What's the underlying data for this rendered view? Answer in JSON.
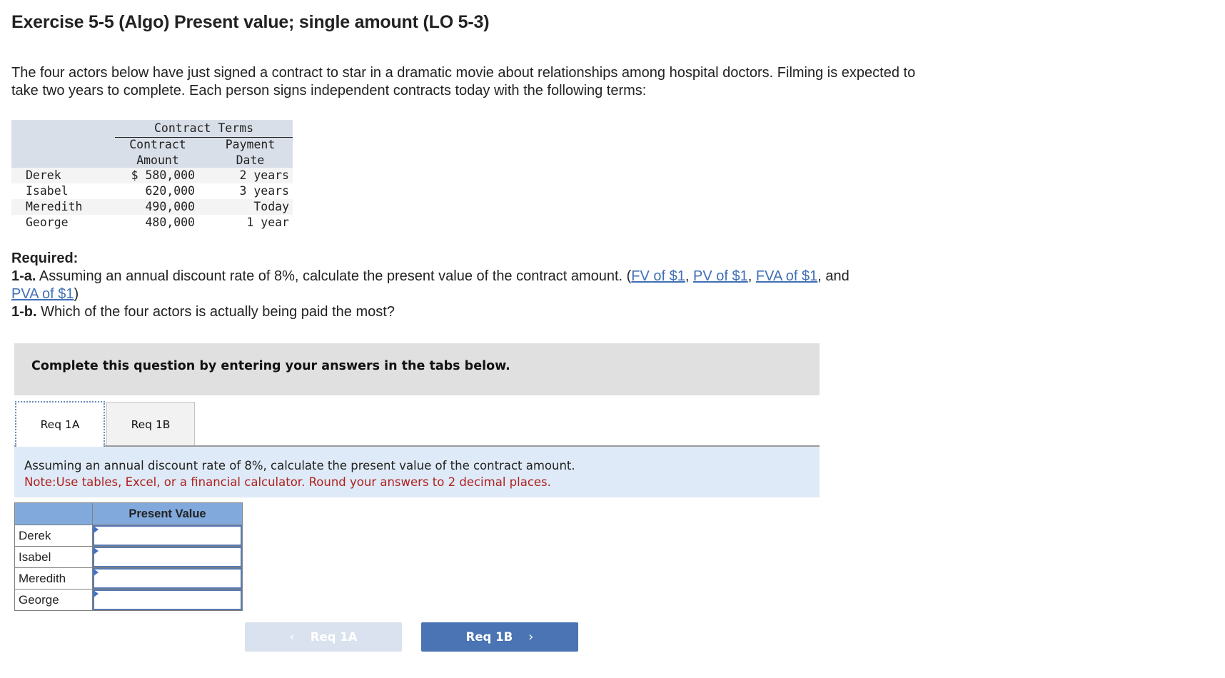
{
  "title": "Exercise 5-5 (Algo) Present value; single amount (LO 5-3)",
  "intro": "The four actors below have just signed a contract to star in a dramatic movie about relationships among hospital doctors. Filming is expected to take two years to complete. Each person signs independent contracts today with the following terms:",
  "contract_table": {
    "group_header": "Contract Terms",
    "col_amount": "Contract Amount",
    "col_date": "Payment Date",
    "rows": [
      {
        "name": "Derek",
        "amount": "$ 580,000",
        "date": "2 years"
      },
      {
        "name": "Isabel",
        "amount": "620,000",
        "date": "3 years"
      },
      {
        "name": "Meredith",
        "amount": "490,000",
        "date": "Today"
      },
      {
        "name": "George",
        "amount": "480,000",
        "date": "1 year"
      }
    ]
  },
  "required": {
    "heading": "Required:",
    "q1a_label": "1-a.",
    "q1a_text": "Assuming an annual discount rate of 8%, calculate the present value of the contract amount. (",
    "links": [
      "FV of $1",
      "PV of $1",
      "FVA of $1",
      "PVA of $1"
    ],
    "sep": ", ",
    "and": ", and ",
    "close": ")",
    "q1b_label": "1-b.",
    "q1b_text": "Which of the four actors is actually being paid the most?"
  },
  "instruction_box": "Complete this question by entering your answers in the tabs below.",
  "tabs": [
    {
      "label": "Req 1A",
      "active": true
    },
    {
      "label": "Req 1B",
      "active": false
    }
  ],
  "note": {
    "line1": "Assuming an annual discount rate of 8%, calculate the present value of the contract amount.",
    "line2": "Note:Use tables, Excel, or a financial calculator. Round your answers to 2 decimal places."
  },
  "answer_table": {
    "header": "Present Value",
    "rows": [
      {
        "label": "Derek",
        "value": ""
      },
      {
        "label": "Isabel",
        "value": ""
      },
      {
        "label": "Meredith",
        "value": ""
      },
      {
        "label": "George",
        "value": ""
      }
    ]
  },
  "nav": {
    "prev_label": "Req 1A",
    "prev_icon": "chevron-left-icon",
    "next_label": "Req 1B",
    "next_icon": "chevron-right-icon"
  },
  "colors": {
    "link": "#3f6fb5",
    "note_red": "#b0201e",
    "next_button": "#4a74b4",
    "prev_button_disabled": "#d9e2ee",
    "table_header_blue": "#82a9dc"
  }
}
